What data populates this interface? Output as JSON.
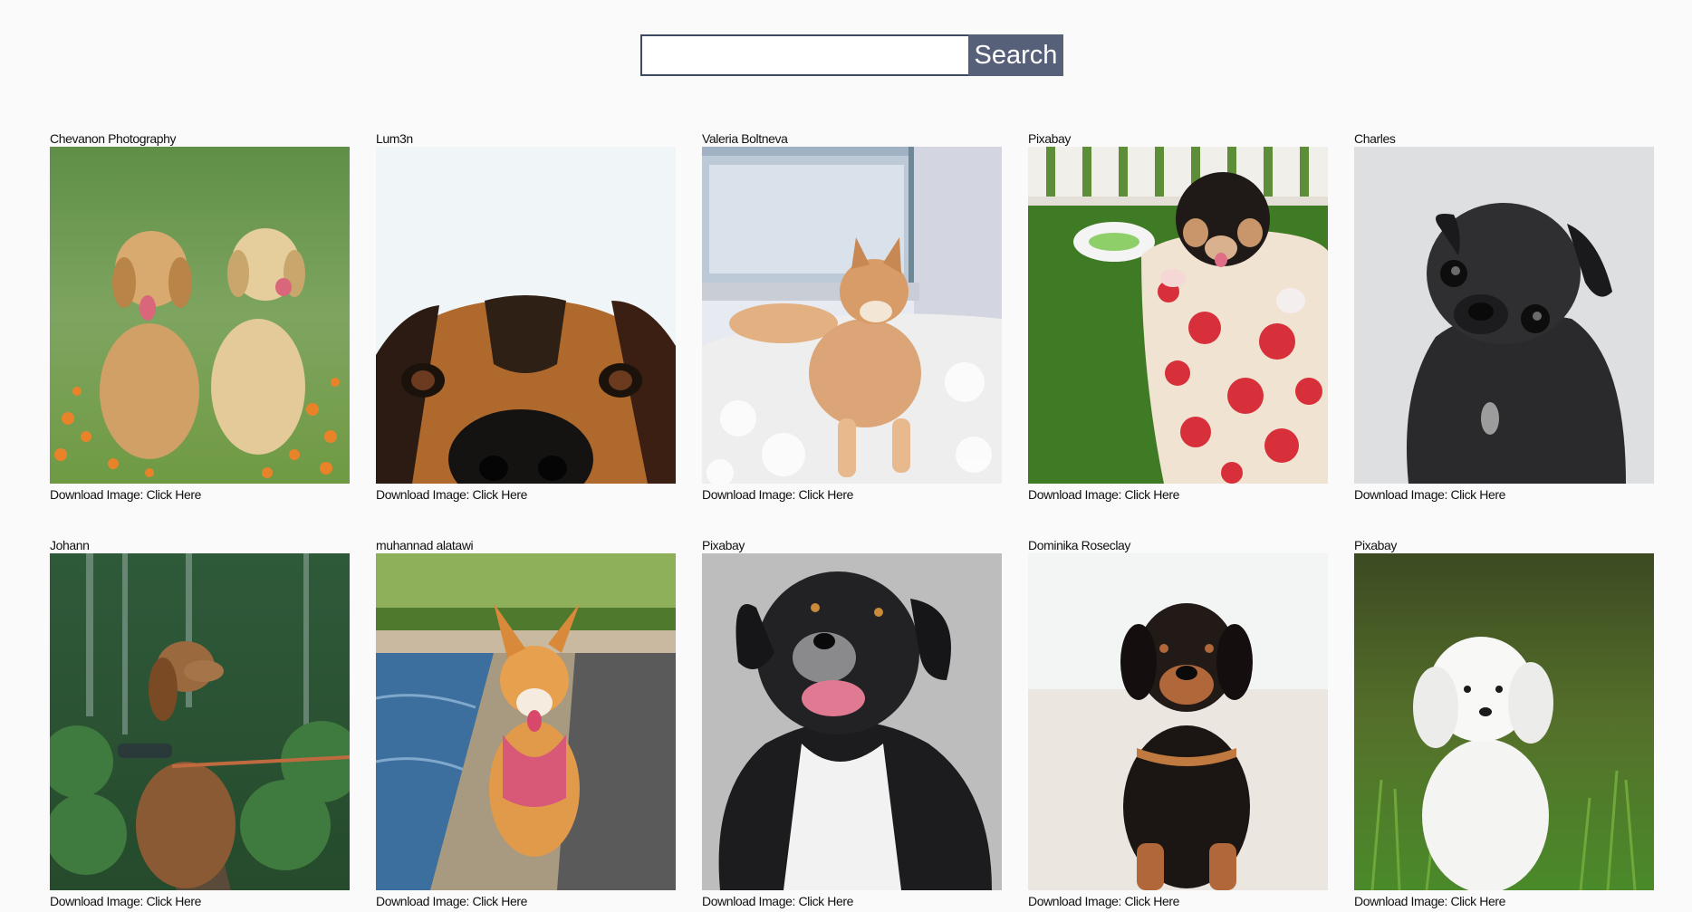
{
  "search": {
    "value": "",
    "placeholder": "",
    "button_label": "Search"
  },
  "download_prefix": "Download Image: ",
  "download_link_label": "Click Here",
  "colors": {
    "search_button_bg": "#566079",
    "search_border": "#3e4a61"
  },
  "cards": [
    {
      "author": "Chevanon Photography",
      "subject": "two golden retriever puppies sitting in grass with orange flowers",
      "icon": "photo-icon"
    },
    {
      "author": "Lum3n",
      "subject": "close-up of a dog's eyes and nose peeking from bottom",
      "icon": "photo-icon"
    },
    {
      "author": "Valeria Boltneva",
      "subject": "shiba inu puppy lying on a white fur rug by a window",
      "icon": "photo-icon"
    },
    {
      "author": "Pixabay",
      "subject": "black and tan chihuahua puppy in a red polka dot cup on grass",
      "icon": "photo-icon"
    },
    {
      "author": "Charles",
      "subject": "black pug puppy looking up on a grey background",
      "icon": "photo-icon"
    },
    {
      "author": "Johann",
      "subject": "spaniel sitting on a leash in a green forest",
      "icon": "photo-icon"
    },
    {
      "author": "muhannad alatawi",
      "subject": "corgi walking on a ledge by the water in a park",
      "icon": "photo-icon"
    },
    {
      "author": "Pixabay",
      "subject": "black and white fluffy dog smiling on a grey background",
      "icon": "photo-icon"
    },
    {
      "author": "Dominika Roseclay",
      "subject": "black and tan puppy sitting on a white background",
      "icon": "photo-icon"
    },
    {
      "author": "Pixabay",
      "subject": "white maltese puppy sitting in grass",
      "icon": "photo-icon"
    }
  ]
}
